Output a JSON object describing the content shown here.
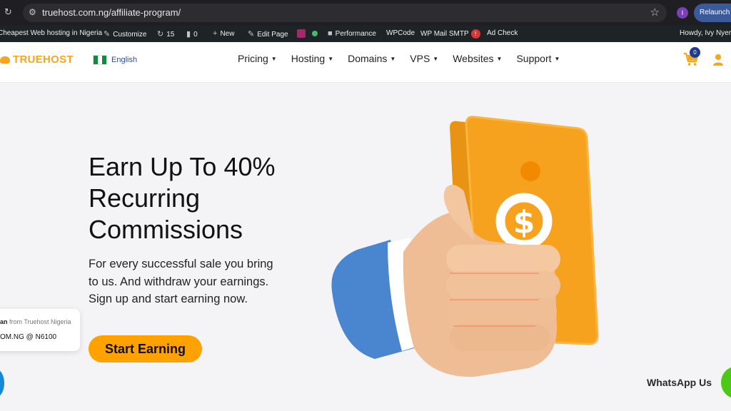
{
  "browser": {
    "url": "truehost.com.ng/affiliate-program/",
    "profile_initial": "I",
    "relaunch_label": "Relaunch to"
  },
  "adminbar": {
    "site_name": "Cheapest Web hosting in Nigeria",
    "customize": "Customize",
    "updates_count": "15",
    "comments_count": "0",
    "new": "New",
    "edit_page": "Edit Page",
    "performance": "Performance",
    "wpcode": "WPCode",
    "wp_mail_smtp": "WP Mail SMTP",
    "wp_mail_badge": "!",
    "ad_check": "Ad Check",
    "howdy": "Howdy, Ivy Nyer"
  },
  "header": {
    "logo_text": "TRUEHOST",
    "language": "English",
    "nav": [
      "Pricing",
      "Hosting",
      "Domains",
      "VPS",
      "Websites",
      "Support"
    ],
    "cart_count": "0"
  },
  "hero": {
    "headline_lines": [
      "Earn Up To 40%",
      "Recurring",
      "Commissions"
    ],
    "subtitle": "For every successful sale you bring to us. And withdraw your earnings. Sign up and start earning now.",
    "cta": "Start Earning"
  },
  "popup": {
    "name": "an",
    "from": "from Truehost Nigeria",
    "purchase": "OM.NG @ N6100"
  },
  "whatsapp": {
    "label": "WhatsApp Us"
  },
  "colors": {
    "brand_orange": "#ffa200",
    "nav_blue": "#2b4f8c",
    "whatsapp_green": "#4cc916"
  }
}
